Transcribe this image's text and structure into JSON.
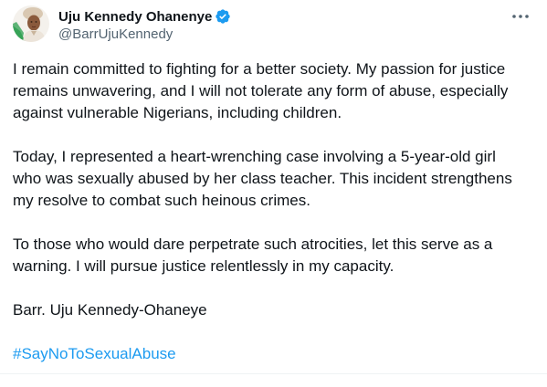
{
  "tweet": {
    "author": {
      "display_name": "Uju Kennedy Ohanenye",
      "handle": "@BarrUjuKennedy",
      "verified": true,
      "avatar_icon": "profile-photo",
      "verified_color": "#1d9bf0"
    },
    "more_icon": "more-horizontal-icon",
    "paragraphs": [
      "I remain committed to fighting for a better society. My passion for justice\nremains unwavering, and I will not tolerate any form of abuse, especially\nagainst vulnerable Nigerians, including children.",
      "Today, I represented a heart-wrenching case involving a 5-year-old girl\nwho was sexually abused by her class teacher. This incident strengthens\nmy resolve to combat such heinous crimes.",
      "To those who would dare perpetrate such atrocities, let this serve as a\nwarning. I will pursue justice relentlessly in my capacity.",
      "Barr. Uju Kennedy-Ohaneye"
    ],
    "hashtag": "#SayNoToSexualAbuse",
    "colors": {
      "text": "#0f1419",
      "secondary": "#536471",
      "link": "#1d9bf0"
    }
  }
}
